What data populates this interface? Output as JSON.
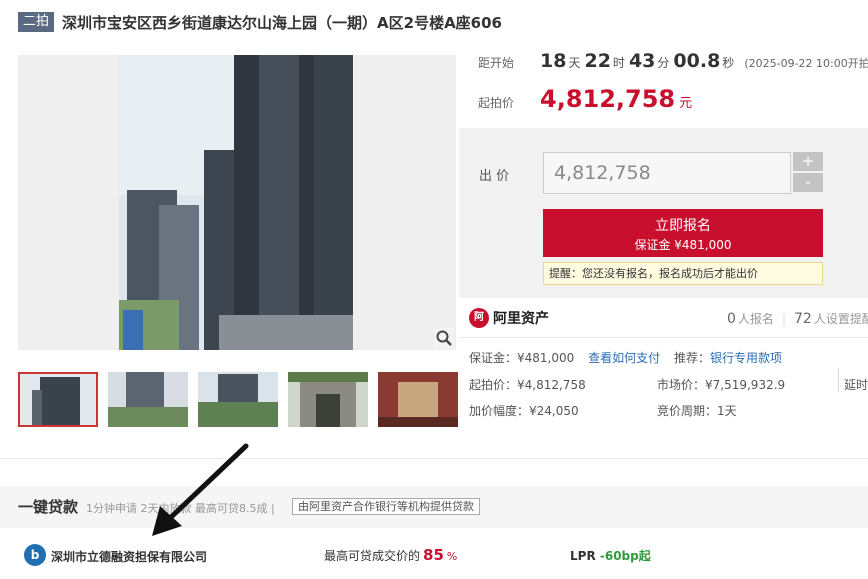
{
  "header": {
    "badge": "二拍",
    "title": "深圳市宝安区西乡街道康达尔山海上园（一期）A区2号楼A座606"
  },
  "countdown": {
    "label": "距开始",
    "days": "18",
    "days_unit": "天",
    "hours": "22",
    "hours_unit": "时",
    "minutes": "43",
    "minutes_unit": "分",
    "seconds": "00.8",
    "seconds_unit": "秒",
    "start_time": "(2025-09-22 10:00开拍)"
  },
  "start_price": {
    "label": "起拍价",
    "value": "4,812,758",
    "unit": "元"
  },
  "bid": {
    "label": "出 价",
    "input_value": "4,812,758",
    "plus": "+",
    "minus": "-",
    "enroll_line1": "立即报名",
    "enroll_line2": "保证金 ¥481,000",
    "tip": "提醒：您还没有报名，报名成功后才能出价"
  },
  "info": {
    "platform": "阿里资产",
    "platform_icon": "阿",
    "enrolled_count": "0",
    "enrolled_label": "人报名",
    "reminder_count": "72",
    "reminder_label": "人设置提醒",
    "deposit": "保证金：¥481,000",
    "how_to_pay": "查看如何支付",
    "recommend": "推荐：",
    "bank_link": "银行专用款项",
    "start_price": "起拍价：¥4,812,758",
    "market_price": "市场价：¥7,519,932.9",
    "delay": "延时",
    "increment": "加价幅度：¥24,050",
    "cycle": "竞价周期：1天"
  },
  "loan": {
    "title": "一键贷款",
    "subtitle": "1分钟申请 2天内放款 最高可贷8.5成 |",
    "tag": "由阿里资产合作银行等机构提供贷款",
    "company_icon": "b",
    "company": "深圳市立德融资担保有限公司",
    "max_label": "最高可贷成交价的",
    "max_pct": "85",
    "pct_sign": "%",
    "lpr_label": "LPR",
    "lpr_value": "-60bp起"
  },
  "colors": {
    "accent": "#c8102e",
    "link": "#2a6db5",
    "badge": "#5a6a82"
  }
}
